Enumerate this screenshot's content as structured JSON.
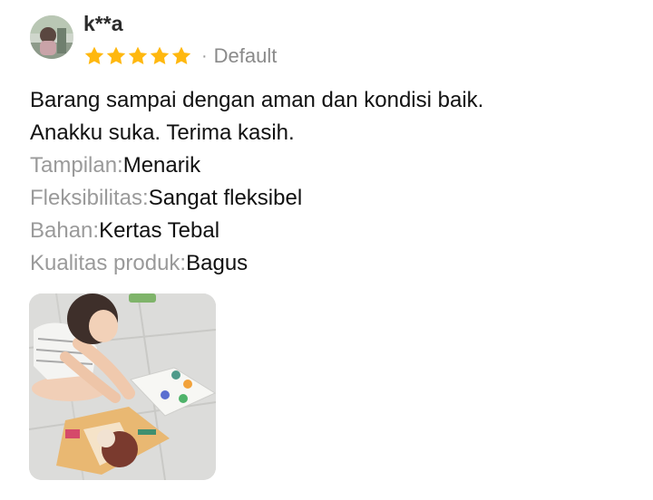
{
  "review": {
    "username": "k**a",
    "rating": 5,
    "rating_max": 5,
    "separator": "·",
    "variant": "Default",
    "text_line_1": "Barang sampai dengan aman dan kondisi baik.",
    "text_line_2": "Anakku suka. Terima kasih.",
    "attributes": [
      {
        "label": "Tampilan:",
        "value": "Menarik"
      },
      {
        "label": "Fleksibilitas:",
        "value": "Sangat fleksibel"
      },
      {
        "label": "Bahan:",
        "value": "Kertas Tebal"
      },
      {
        "label": "Kualitas produk:",
        "value": "Bagus"
      }
    ]
  },
  "icons": {
    "avatar": "user-avatar-photo",
    "star": "star-filled-icon",
    "photo": "review-photo-thumbnail"
  },
  "colors": {
    "star": "#FFB80F",
    "label_gray": "#9A9A9A",
    "text": "#111111",
    "username": "#2B2B2B"
  }
}
